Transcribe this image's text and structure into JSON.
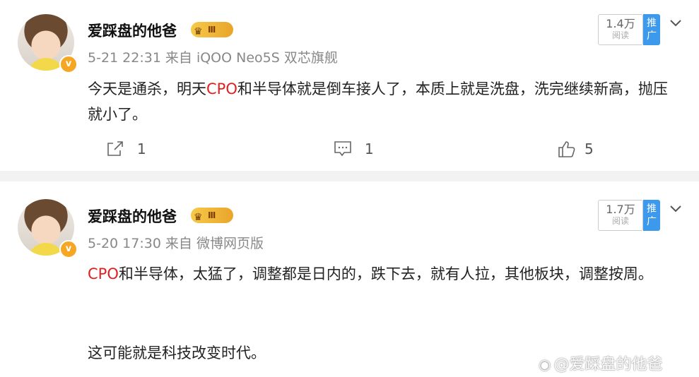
{
  "posts": [
    {
      "username": "爱踩盘的他爸",
      "level_badge": "Ⅲ",
      "verified_badge": "v",
      "date": "5-21 22:31",
      "source_prefix": "来自",
      "source": "iQOO Neo5S 双芯旗舰",
      "reads": "1.4万",
      "reads_label": "阅读",
      "promote_label_1": "推",
      "promote_label_2": "广",
      "content_pre": "今天是通杀，明天",
      "content_highlight": "CPO",
      "content_post": "和半导体就是倒车接人了，本质上就是洗盘，洗完继续新高，抛压就小了。",
      "shares": "1",
      "comments": "1",
      "likes": "5"
    },
    {
      "username": "爱踩盘的他爸",
      "level_badge": "Ⅲ",
      "verified_badge": "v",
      "date": "5-20 17:30",
      "source_prefix": "来自",
      "source": "微博网页版",
      "reads": "1.7万",
      "reads_label": "阅读",
      "promote_label_1": "推",
      "promote_label_2": "广",
      "content_highlight": "CPO",
      "content_post": "和半导体，太猛了，调整都是日内的，跌下去，就有人拉，其他板块，调整按周。",
      "content_line2": "这可能就是科技改变时代。"
    }
  ],
  "watermark": "@爱踩盘的他爸",
  "colors": {
    "highlight": "#e02020",
    "promote": "#3d99ec",
    "badge": "#f5a623",
    "divider": "#f2f2f2"
  },
  "icons": [
    "share-icon",
    "comment-icon",
    "like-icon",
    "chevron-down-icon",
    "crown-icon",
    "weibo-logo-icon"
  ]
}
